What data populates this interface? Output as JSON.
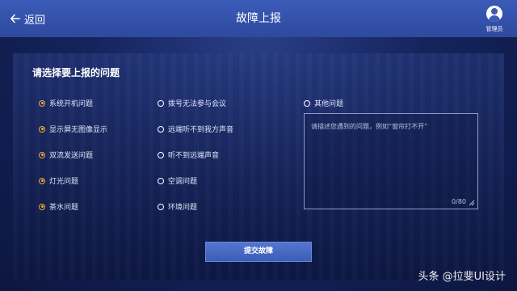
{
  "header": {
    "back_label": "返回",
    "title": "故障上报",
    "user_label": "管理员"
  },
  "form": {
    "question": "请选择要上报的问题",
    "options": [
      {
        "label": "系统开机问题",
        "selected": true
      },
      {
        "label": "显示屏无图像显示",
        "selected": true
      },
      {
        "label": "双流发送问题",
        "selected": true
      },
      {
        "label": "灯光问题",
        "selected": true
      },
      {
        "label": "茶水问题",
        "selected": true
      },
      {
        "label": "拨号无法参与会议",
        "selected": false
      },
      {
        "label": "远端听不到我方声音",
        "selected": false
      },
      {
        "label": "听不到远端声音",
        "selected": false
      },
      {
        "label": "空调问题",
        "selected": false
      },
      {
        "label": "环境问题",
        "selected": false
      },
      {
        "label": "其他问题",
        "selected": false
      }
    ],
    "textarea_placeholder": "请描述您遇到的问题，例如“窗帘打不开”",
    "char_count": "0/80",
    "submit_label": "提交故障"
  },
  "watermark": "头条 @拉斐UI设计",
  "colors": {
    "accent": "#f0a93a",
    "topbar": "#3b5bb8",
    "button": "#4a6cc8"
  }
}
